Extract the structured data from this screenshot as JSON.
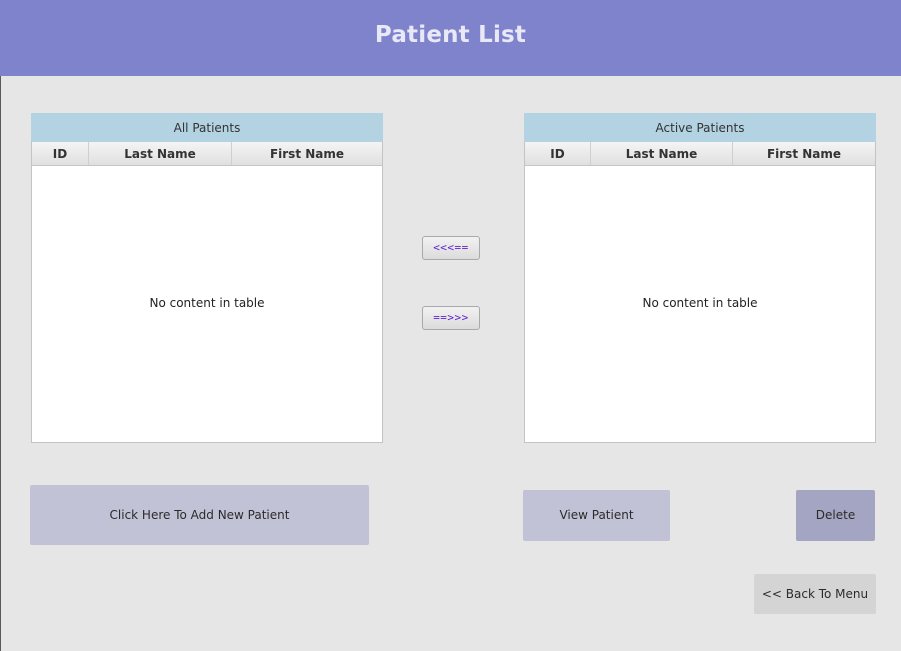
{
  "header": {
    "title": "Patient List"
  },
  "all_patients_table": {
    "caption": "All Patients",
    "columns": [
      "ID",
      "Last Name",
      "First Name"
    ],
    "placeholder": "No content in table"
  },
  "active_patients_table": {
    "caption": "Active Patients",
    "columns": [
      "ID",
      "Last Name",
      "First Name"
    ],
    "placeholder": "No content in table"
  },
  "transfer": {
    "move_left_label": "<<<==",
    "move_right_label": "==>>>"
  },
  "actions": {
    "add_label": "Click Here To Add New Patient",
    "view_label": "View Patient",
    "delete_label": "Delete",
    "back_label": "<< Back To Menu"
  },
  "colors": {
    "header_bg": "#7f83cc",
    "table_caption_bg": "#b3d2e2",
    "button_bg": "#c2c2d6",
    "delete_button_bg": "#a4a4c3",
    "arrow_text": "#5b1fd0"
  }
}
